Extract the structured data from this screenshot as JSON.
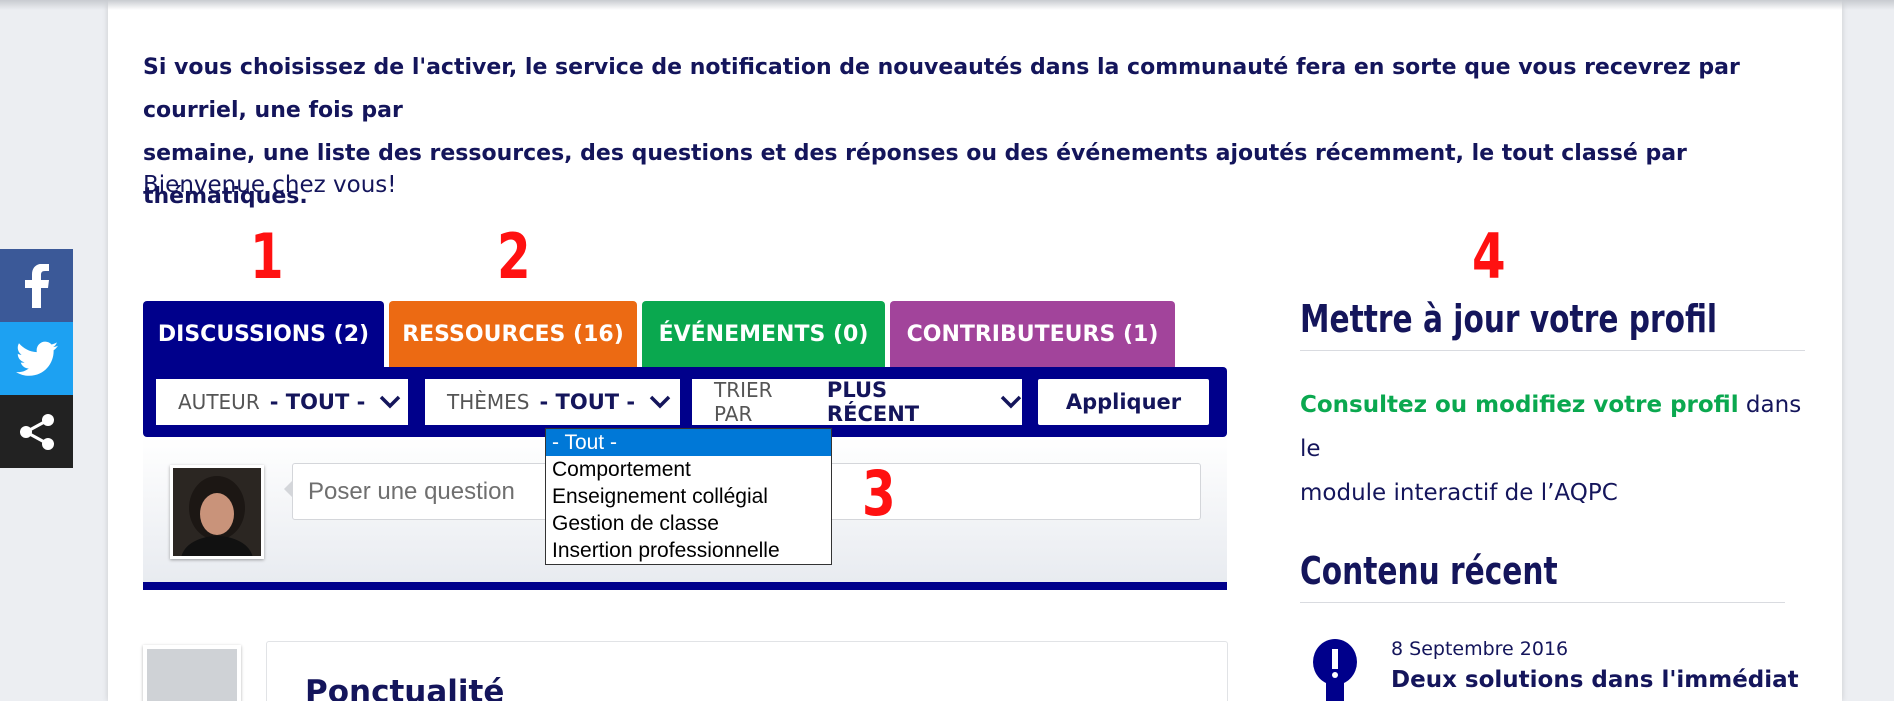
{
  "intro": {
    "line1": "Si vous choisissez de l'activer, le service de notification de nouveautés dans la communauté fera en sorte que vous recevrez par courriel, une fois par",
    "line2": "semaine, une liste des ressources, des questions et des réponses ou des événements ajoutés récemment, le tout classé par thématiques.",
    "welcome": "Bienvenue chez vous!"
  },
  "annotations": [
    "1",
    "2",
    "3",
    "4"
  ],
  "social": {
    "facebook_icon": "facebook-icon",
    "twitter_icon": "twitter-icon",
    "share_icon": "share-icon",
    "colors": {
      "facebook": "#3b5998",
      "twitter": "#1da1f2",
      "share": "#222222"
    }
  },
  "tabs": [
    {
      "label": "DISCUSSIONS (2)",
      "color": "#00008b"
    },
    {
      "label": "RESSOURCES (16)",
      "color": "#ec6a13"
    },
    {
      "label": "ÉVÉNEMENTS (0)",
      "color": "#0aa84f"
    },
    {
      "label": "CONTRIBUTEURS (1)",
      "color": "#a2449b"
    }
  ],
  "filters": {
    "author": {
      "label": "AUTEUR",
      "value": "- TOUT -"
    },
    "themes": {
      "label": "THÈMES",
      "value": "- TOUT -"
    },
    "sort": {
      "label": "TRIER PAR",
      "value": "PLUS RÉCENT"
    },
    "apply_label": "Appliquer"
  },
  "theme_dropdown": {
    "options": [
      "- Tout -",
      "Comportement",
      "Enseignement collégial",
      "Gestion de classe",
      "Insertion professionnelle"
    ],
    "selected": "- Tout -"
  },
  "question": {
    "placeholder": "Poser une question"
  },
  "post": {
    "title": "Ponctualité"
  },
  "sidebar": {
    "profile_heading": "Mettre à jour votre profil",
    "profile_link": "Consultez ou modifiez votre profil",
    "profile_text_1": " dans le",
    "profile_text_2": "module interactif de l’AQPC",
    "recent_heading": "Contenu récent",
    "recent_items": [
      {
        "date": "8 Septembre 2016",
        "title": "Deux solutions dans l'immédiat",
        "icon": "lightbulb-icon"
      }
    ]
  },
  "accent_colors": {
    "navy": "#00008b",
    "text": "#14155b",
    "green": "#0aa84f",
    "annotation": "#ff1111"
  }
}
